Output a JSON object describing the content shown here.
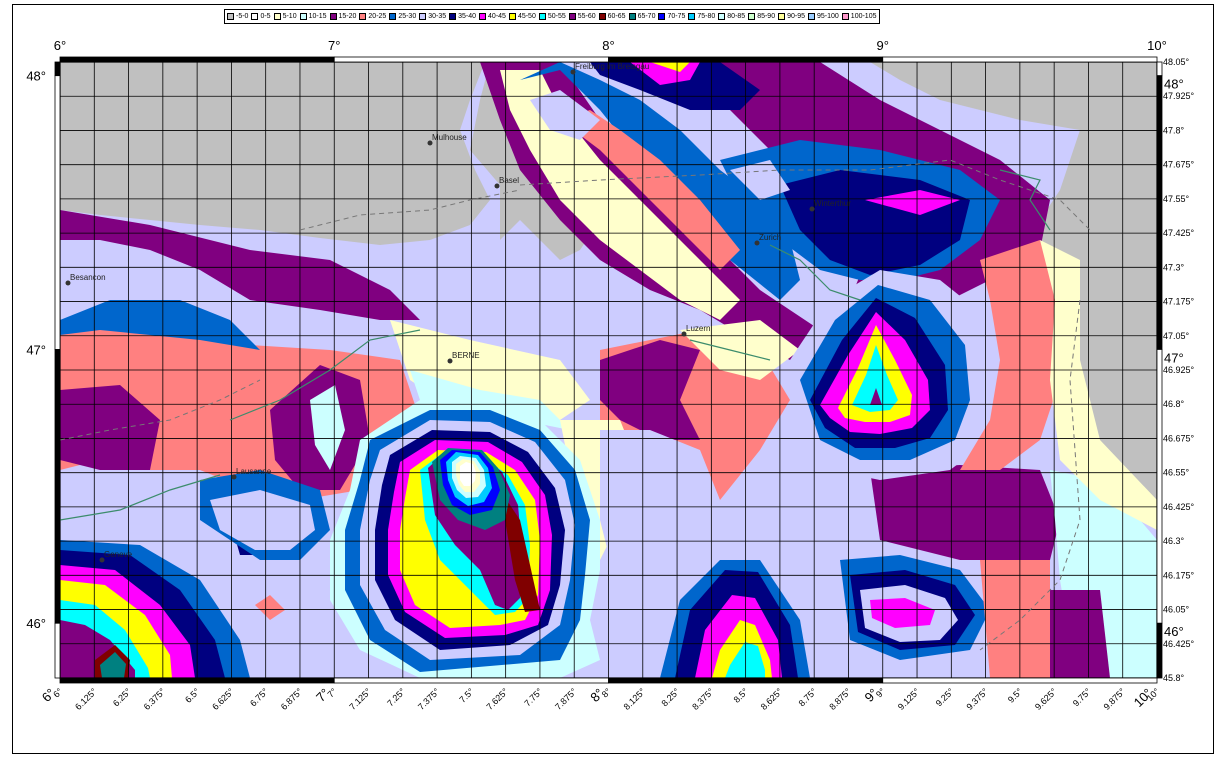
{
  "legend": [
    {
      "label": "-5-0",
      "color": "#c0c0c0"
    },
    {
      "label": "0-5",
      "color": "#ffffff"
    },
    {
      "label": "5-10",
      "color": "#ffffcc"
    },
    {
      "label": "10-15",
      "color": "#ccffff"
    },
    {
      "label": "15-20",
      "color": "#800080"
    },
    {
      "label": "20-25",
      "color": "#ff8080"
    },
    {
      "label": "25-30",
      "color": "#0066cc"
    },
    {
      "label": "30-35",
      "color": "#ccccff"
    },
    {
      "label": "35-40",
      "color": "#000080"
    },
    {
      "label": "40-45",
      "color": "#ff00ff"
    },
    {
      "label": "45-50",
      "color": "#ffff00"
    },
    {
      "label": "50-55",
      "color": "#00ffff"
    },
    {
      "label": "55-60",
      "color": "#800080"
    },
    {
      "label": "60-65",
      "color": "#800000"
    },
    {
      "label": "65-70",
      "color": "#008080"
    },
    {
      "label": "70-75",
      "color": "#0000ff"
    },
    {
      "label": "75-80",
      "color": "#00ccff"
    },
    {
      "label": "80-85",
      "color": "#ccffff"
    },
    {
      "label": "85-90",
      "color": "#ccffcc"
    },
    {
      "label": "90-95",
      "color": "#ffff99"
    },
    {
      "label": "95-100",
      "color": "#99ccff"
    },
    {
      "label": "100-105",
      "color": "#ff99cc"
    }
  ],
  "axes": {
    "top_labels": [
      "6°",
      "7°",
      "8°",
      "9°",
      "10°"
    ],
    "bottom_labels": [
      "6°",
      "6.125°",
      "6.25°",
      "6.375°",
      "6.5°",
      "6.625°",
      "6.75°",
      "6.875°",
      "7°",
      "7.125°",
      "7.25°",
      "7.375°",
      "7.5°",
      "7.625°",
      "7.75°",
      "7.875°",
      "8°",
      "8.125°",
      "8.25°",
      "8.375°",
      "8.5°",
      "8.625°",
      "8.75°",
      "8.875°",
      "9°",
      "9.125°",
      "9.25°",
      "9.375°",
      "9.5°",
      "9.625°",
      "9.75°",
      "9.875°",
      "10°"
    ],
    "bottom_major_labels": [
      "6°",
      "7°",
      "8°",
      "9°",
      "10°"
    ],
    "left_labels": [
      "48°",
      "47°",
      "46°"
    ],
    "right_major_labels": [
      "48°",
      "47°",
      "46°"
    ],
    "right_labels": [
      "48.05°",
      "47.925°",
      "47.8°",
      "47.675°",
      "47.55°",
      "47.425°",
      "47.3°",
      "47.175°",
      "47.05°",
      "46.925°",
      "46.8°",
      "46.675°",
      "46.55°",
      "46.425°",
      "46.3°",
      "46.175°",
      "46.05°",
      "46.425°",
      "45.8°"
    ]
  },
  "cities": [
    {
      "name": "Mulhouse"
    },
    {
      "name": "Basel"
    },
    {
      "name": "Freiburg im Breisgau"
    },
    {
      "name": "Winterthur"
    },
    {
      "name": "Zurich"
    },
    {
      "name": "Besancon"
    },
    {
      "name": "Luzern"
    },
    {
      "name": "BERNE"
    },
    {
      "name": "Lausanne"
    },
    {
      "name": "Geneve"
    }
  ]
}
